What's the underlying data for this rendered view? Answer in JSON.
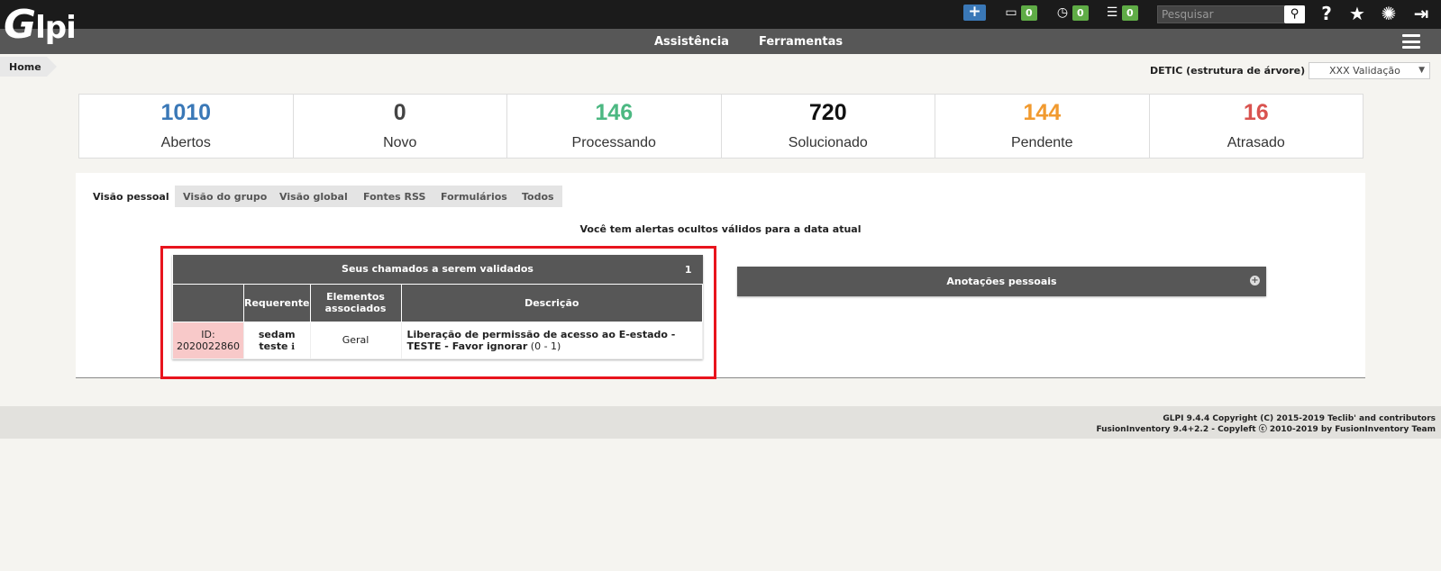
{
  "app": {
    "logo_text": "lpi",
    "logo_initial": "G"
  },
  "topbar": {
    "add_label": "+",
    "counters": [
      {
        "icon": "ticket-icon",
        "glyph": "▭",
        "count": "0"
      },
      {
        "icon": "clock-icon",
        "glyph": "◷",
        "count": "0"
      },
      {
        "icon": "tasks-icon",
        "glyph": "☰",
        "count": "0"
      }
    ],
    "search_placeholder": "Pesquisar",
    "search_glyph": "⚲",
    "help_glyph": "?",
    "star_glyph": "★",
    "settings_glyph": "✺",
    "logout_glyph": "⇥"
  },
  "nav": {
    "items": [
      "Assistência",
      "Ferramentas"
    ]
  },
  "breadcrumb": {
    "home": "Home"
  },
  "entity": {
    "label": "DETIC (estrutura de árvore)",
    "selected": "XXX Validação",
    "arrow": "▼"
  },
  "stats": [
    {
      "value": "1010",
      "label": "Abertos",
      "color": "#3a78b7"
    },
    {
      "value": "0",
      "label": "Novo",
      "color": "#444444"
    },
    {
      "value": "146",
      "label": "Processando",
      "color": "#4cb882"
    },
    {
      "value": "720",
      "label": "Solucionado",
      "color": "#111111"
    },
    {
      "value": "144",
      "label": "Pendente",
      "color": "#f19a2f"
    },
    {
      "value": "16",
      "label": "Atrasado",
      "color": "#d9534f"
    }
  ],
  "tabs": [
    "Visão pessoal",
    "Visão do grupo",
    "Visão global",
    "Fontes RSS",
    "Formulários",
    "Todos"
  ],
  "alert_message": "Você tem alertas ocultos válidos para a data atual",
  "validation": {
    "title": "Seus chamados a serem validados",
    "count": "1",
    "columns": [
      "",
      "Requerente",
      "Elementos associados",
      "Descrição"
    ],
    "rows": [
      {
        "id": "ID: 2020022860",
        "requester": "sedam teste",
        "info_glyph": "ℹ",
        "element": "Geral",
        "description": "Liberação de permissão de acesso ao E-estado - TESTE - Favor ignorar",
        "extra": "(0 - 1)"
      }
    ]
  },
  "notes": {
    "title": "Anotações pessoais",
    "plus": "+"
  },
  "footer": {
    "line1": "GLPI 9.4.4 Copyright (C) 2015-2019 Teclib' and contributors",
    "line2a": "FusionInventory 9.4+2.2 - Copyleft",
    "copyleft_glyph": "ⓒ",
    "line2b": "2010-2019 by FusionInventory Team"
  }
}
